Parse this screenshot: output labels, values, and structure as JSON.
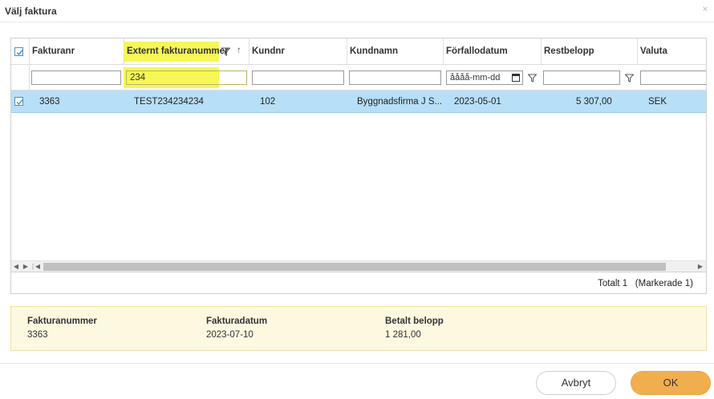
{
  "dialog": {
    "title": "Välj faktura",
    "close_glyph": "×"
  },
  "grid": {
    "columns": [
      {
        "key": "fakturanr",
        "label": "Fakturanr"
      },
      {
        "key": "externt",
        "label": "Externt fakturanummer",
        "sort": "↑"
      },
      {
        "key": "kundnr",
        "label": "Kundnr"
      },
      {
        "key": "kundnamn",
        "label": "Kundnamn"
      },
      {
        "key": "forfallodatum",
        "label": "Förfallodatum"
      },
      {
        "key": "restbelopp",
        "label": "Restbelopp"
      },
      {
        "key": "valuta",
        "label": "Valuta"
      }
    ],
    "filters": {
      "fakturanr": "",
      "externt": "234",
      "kundnr": "",
      "kundnamn": "",
      "forfallodatum_placeholder": "åååå-mm-dd",
      "restbelopp": "",
      "valuta": ""
    },
    "rows": [
      {
        "fakturanr": "3363",
        "externt": "TEST234234234",
        "kundnr": "102",
        "kundnamn": "Byggnadsfirma J S...",
        "forfallodatum": "2023-05-01",
        "restbelopp": "5 307,00",
        "valuta": "SEK"
      }
    ],
    "footer": {
      "total": "Totalt 1",
      "marked": "(Markerade 1)"
    }
  },
  "details": {
    "fakturanummer_label": "Fakturanummer",
    "fakturanummer_value": "3363",
    "fakturadatum_label": "Fakturadatum",
    "fakturadatum_value": "2023-07-10",
    "betalt_label": "Betalt belopp",
    "betalt_value": "1 281,00"
  },
  "buttons": {
    "cancel": "Avbryt",
    "ok": "OK"
  },
  "colors": {
    "highlight": "#f5f53a",
    "selected_row": "#b7dff8",
    "ok_button": "#f1ae4f",
    "details_bg": "#fdf8e0"
  }
}
